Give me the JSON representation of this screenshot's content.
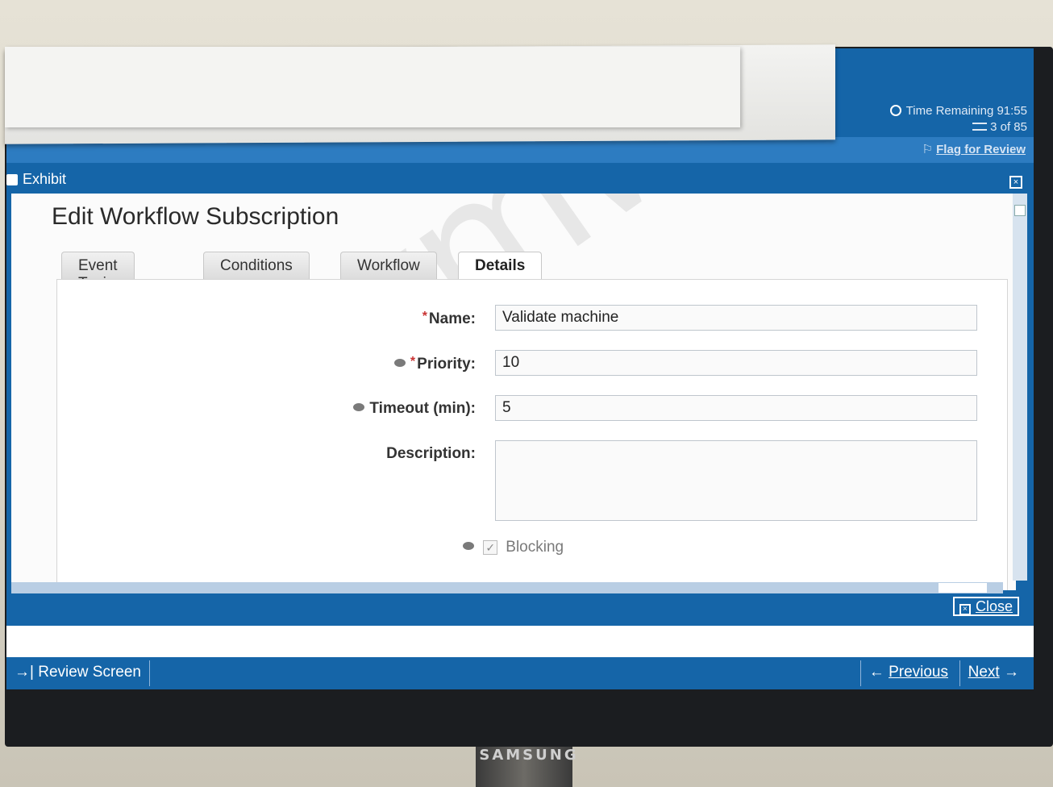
{
  "header": {
    "time_remaining": "Time Remaining 91:55",
    "question_counter": "3 of 85",
    "flag_for_review": "Flag for Review"
  },
  "exhibit": {
    "title": "Exhibit",
    "form_title": "Edit Workflow Subscription",
    "tabs": [
      {
        "label": "Event Topic"
      },
      {
        "label": "Conditions"
      },
      {
        "label": "Workflow"
      },
      {
        "label": "Details",
        "active": true
      }
    ],
    "fields": {
      "name_label": "Name:",
      "name_value": "Validate machine",
      "priority_label": "Priority:",
      "priority_value": "10",
      "timeout_label": "Timeout (min):",
      "timeout_value": "5",
      "description_label": "Description:",
      "description_value": "",
      "blocking_label": "Blocking",
      "blocking_checked": true
    },
    "watermark": "vmware",
    "close_label": "Close"
  },
  "footer": {
    "review_screen": "Review Screen",
    "previous": "Previous",
    "next": "Next"
  },
  "monitor": {
    "brand": "SAMSUNG"
  },
  "colors": {
    "bar_blue": "#1565a8",
    "required_red": "#c83232"
  }
}
